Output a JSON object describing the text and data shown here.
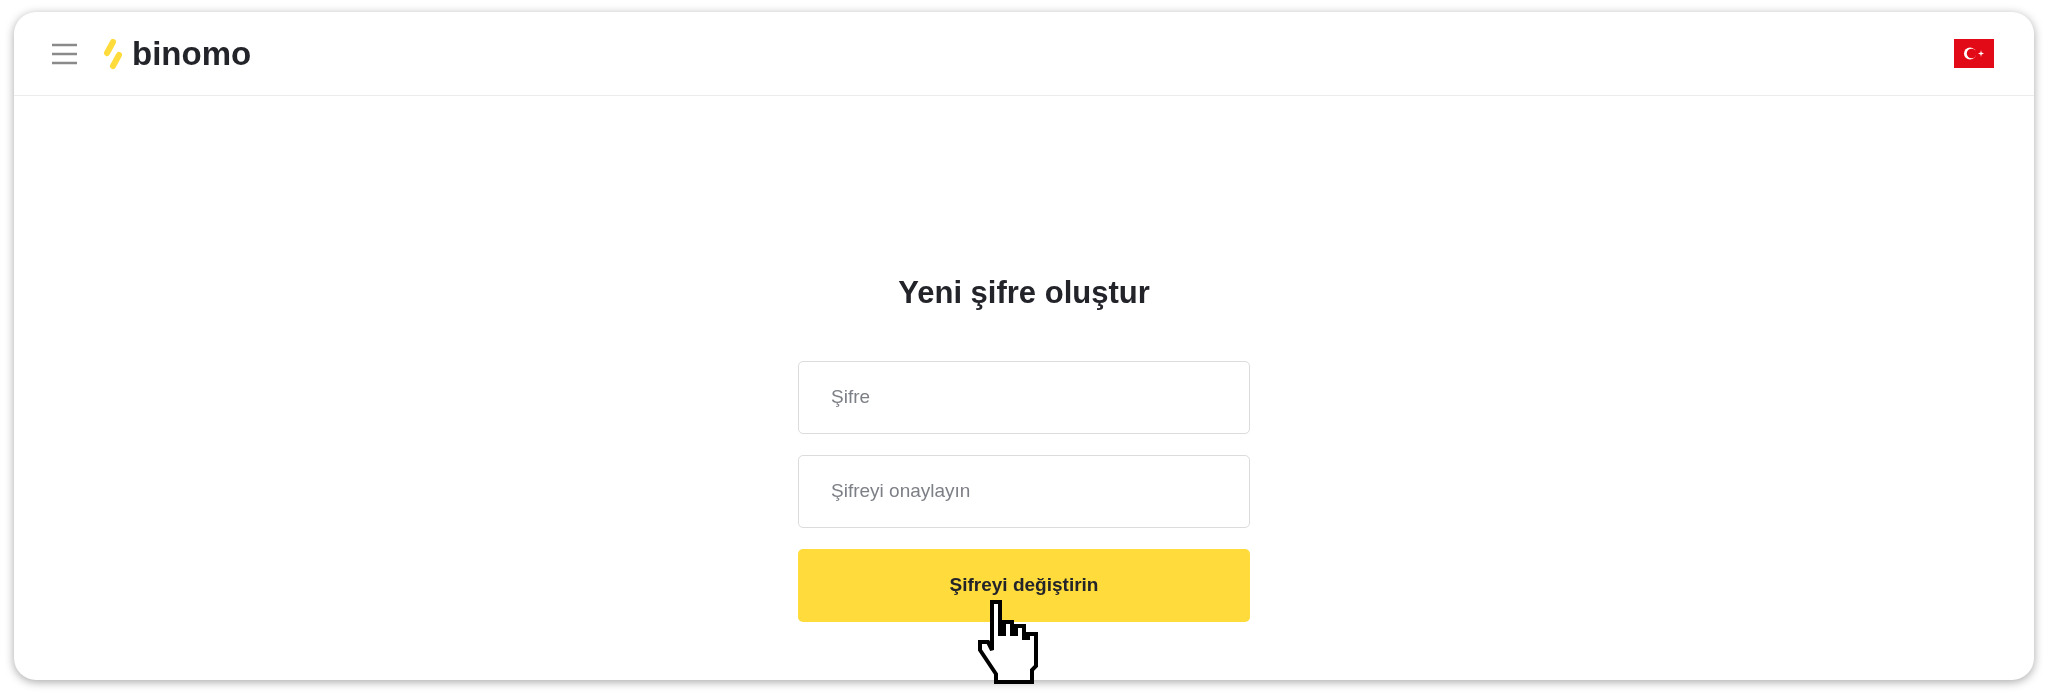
{
  "header": {
    "logo": "binomo"
  },
  "form": {
    "title": "Yeni şifre oluştur",
    "fields": [
      {
        "placeholder": "Şifre"
      },
      {
        "placeholder": "Şifreyi onaylayın"
      }
    ],
    "submit": "Şifreyi değiştirin"
  }
}
